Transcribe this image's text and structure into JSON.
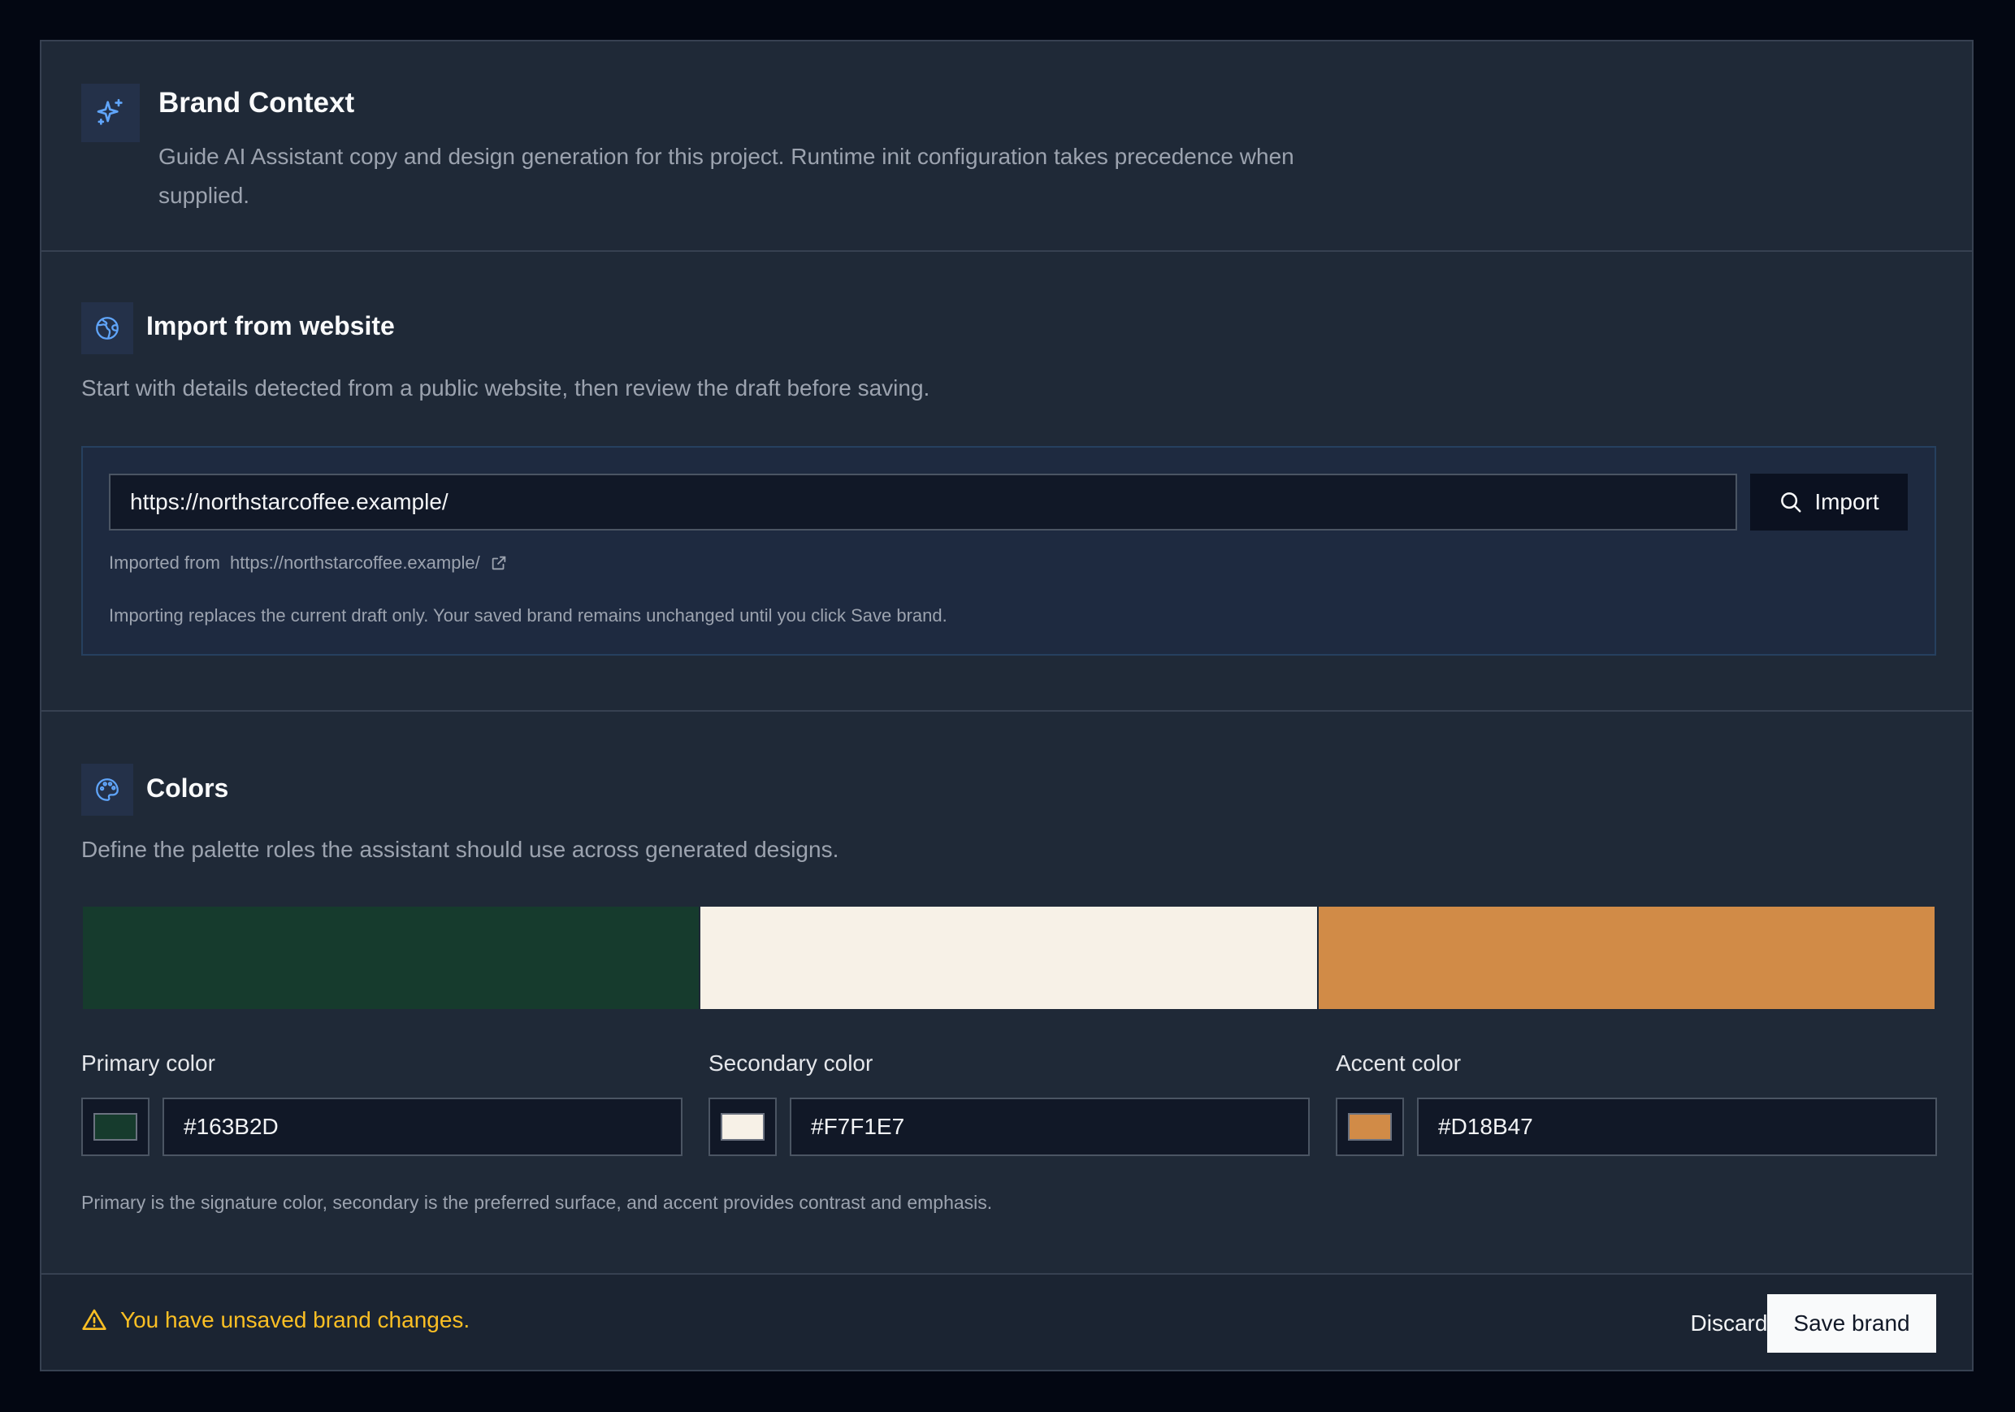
{
  "header": {
    "title": "Brand Context",
    "description": "Guide AI Assistant copy and design generation for this project. Runtime init configuration takes precedence when supplied.",
    "icon": "sparkles-icon"
  },
  "import": {
    "title": "Import from website",
    "description": "Start with details detected from a public website, then review the draft before saving.",
    "icon": "globe-icon",
    "url_value": "https://northstarcoffee.example/",
    "button_label": "Import",
    "imported_from_label": "Imported from",
    "imported_from_url": "https://northstarcoffee.example/",
    "note": "Importing replaces the current draft only. Your saved brand remains unchanged until you click Save brand."
  },
  "colors": {
    "title": "Colors",
    "description": "Define the palette roles the assistant should use across generated designs.",
    "icon": "palette-icon",
    "primary": {
      "label": "Primary color",
      "hex": "#163B2D"
    },
    "secondary": {
      "label": "Secondary color",
      "hex": "#F7F1E7"
    },
    "accent": {
      "label": "Accent color",
      "hex": "#D18B47"
    },
    "note": "Primary is the signature color, secondary is the preferred surface, and accent provides contrast and emphasis."
  },
  "footer": {
    "warning": "You have unsaved brand changes.",
    "discard_label": "Discard",
    "save_label": "Save brand"
  },
  "theme": {
    "page_bg": "#030712",
    "panel_bg": "#1f2937",
    "icon_accent": "#60a5fa",
    "warning": "#fbbf24"
  }
}
